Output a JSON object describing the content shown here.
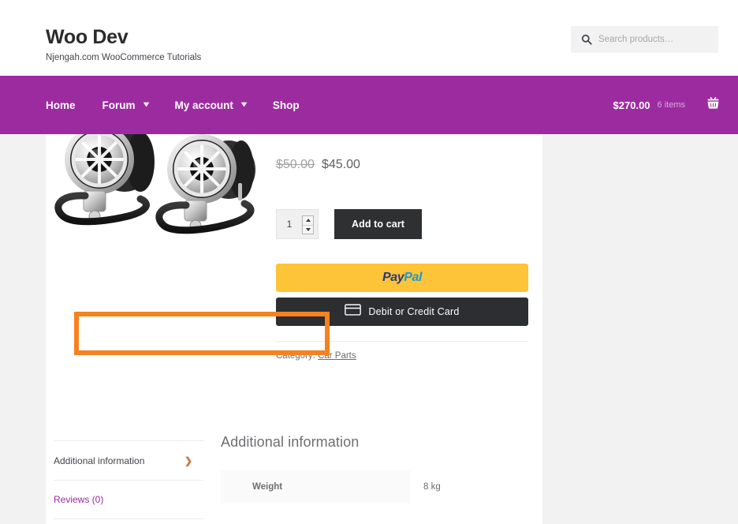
{
  "site": {
    "title": "Woo Dev",
    "tagline": "Njengah.com WooCommerce Tutorials"
  },
  "search": {
    "placeholder": "Search products…",
    "value": "",
    "icon": "search-icon"
  },
  "nav": {
    "background_color": "#9d2ba0",
    "items": [
      {
        "label": "Home",
        "has_dropdown": false
      },
      {
        "label": "Forum",
        "has_dropdown": true,
        "chevron": "▾"
      },
      {
        "label": "My account",
        "has_dropdown": true,
        "chevron": "▾"
      },
      {
        "label": "Shop",
        "has_dropdown": false
      }
    ],
    "cart": {
      "amount": "$270.00",
      "items_count": "6 items",
      "icon": "shopping-basket-icon"
    }
  },
  "product": {
    "image_alt": "chrome motorcycle speakers pair",
    "price_old": "$50.00",
    "price_new": "$45.00",
    "quantity": "1",
    "add_to_cart_label": "Add to cart",
    "category_label": "Category:",
    "category_value": "Car Parts"
  },
  "paypal": {
    "brand_first": "Pay",
    "brand_second": "Pal",
    "brand_color_first": "#253b80",
    "brand_color_second": "#179bd7",
    "background_color": "#fdc439",
    "card_button_label": "Debit or Credit Card",
    "card_icon": "credit-card-icon",
    "card_background_color": "#2c2e2f"
  },
  "tabs": [
    {
      "label": "Additional information",
      "active": true,
      "chevron": "❯"
    },
    {
      "label": "Reviews (0)",
      "active": false,
      "chevron": ""
    }
  ],
  "panel": {
    "heading": "Additional information",
    "table": {
      "rows": [
        {
          "label": "Weight",
          "value": "8 kg"
        }
      ]
    }
  },
  "annotation": {
    "highlight_color": "#f58220",
    "target": "weight-attribute-row"
  }
}
